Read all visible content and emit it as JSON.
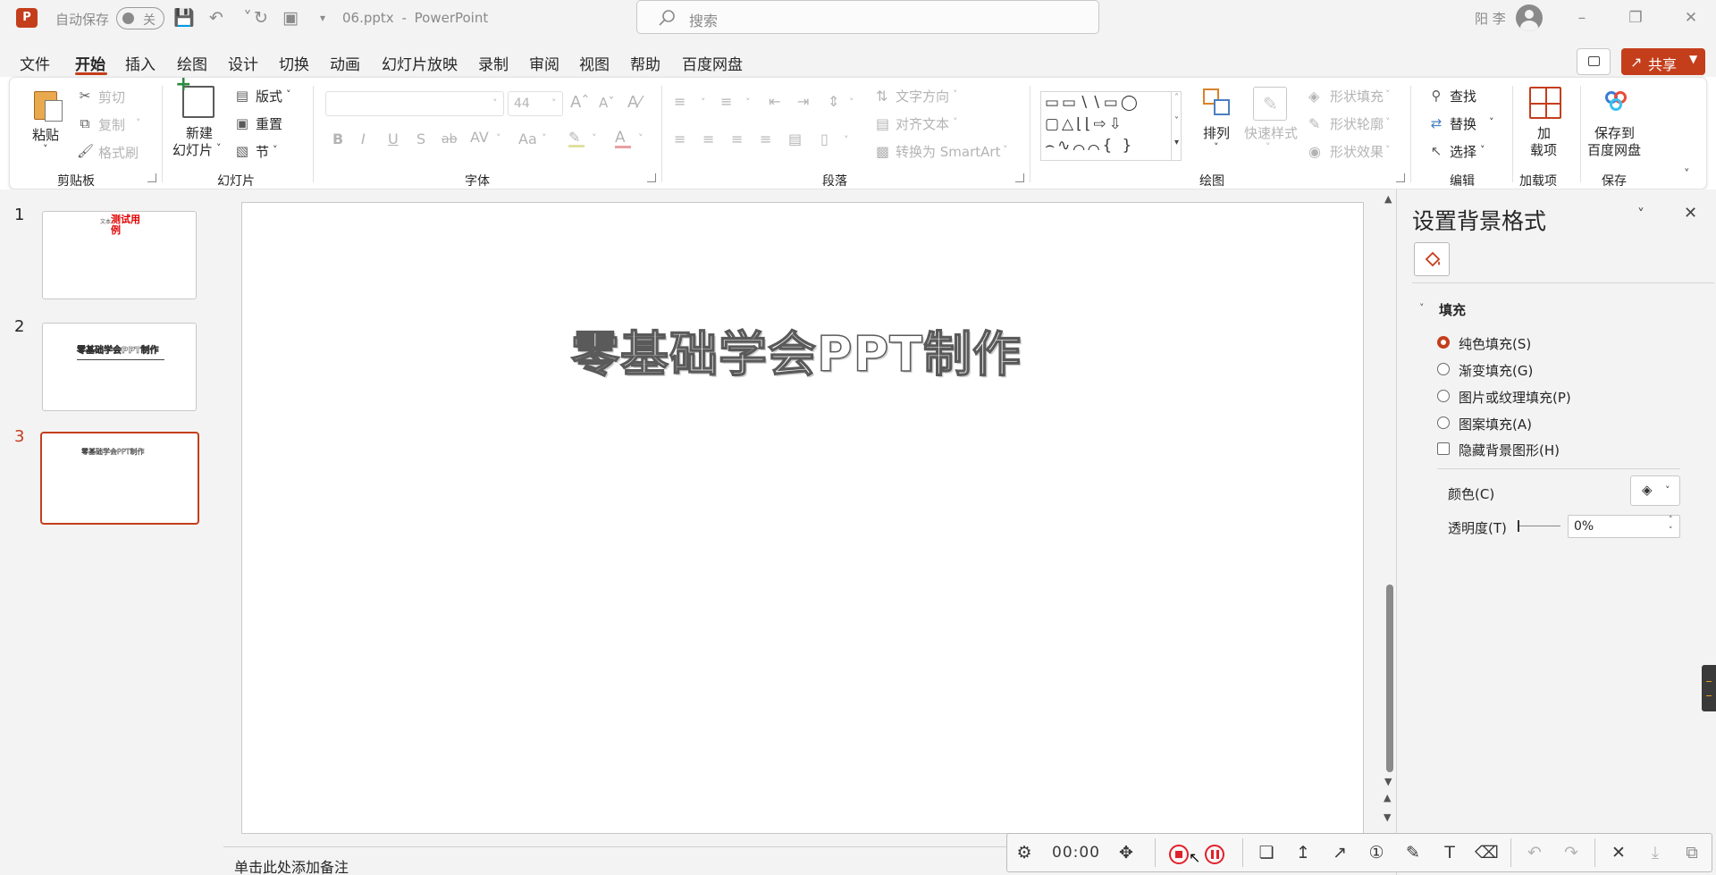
{
  "titlebar": {
    "app_icon": "P",
    "autosave_label": "自动保存",
    "autosave_state": "关",
    "filename": "06.pptx",
    "separator": "-",
    "app_name": "PowerPoint",
    "search_placeholder": "搜索",
    "user_name": "阳 李"
  },
  "menu": {
    "items": [
      "文件",
      "开始",
      "插入",
      "绘图",
      "设计",
      "切换",
      "动画",
      "幻灯片放映",
      "录制",
      "审阅",
      "视图",
      "帮助",
      "百度网盘"
    ],
    "active": "开始",
    "share_label": "共享"
  },
  "ribbon": {
    "clipboard": {
      "paste": "粘贴",
      "cut": "剪切",
      "copy": "复制",
      "format_painter": "格式刷",
      "group": "剪贴板"
    },
    "slides": {
      "new_slide_1": "新建",
      "new_slide_2": "幻灯片",
      "layout": "版式",
      "reset": "重置",
      "section": "节",
      "group": "幻灯片"
    },
    "font": {
      "font_name": "",
      "font_size": "44",
      "bold": "B",
      "italic": "I",
      "underline": "U",
      "shadow": "S",
      "strike": "ab",
      "spacing": "AV",
      "case": "Aa",
      "color_a": "A",
      "group": "字体"
    },
    "paragraph": {
      "text_direction": "文字方向",
      "align_text": "对齐文本",
      "smartart": "转换为 SmartArt",
      "group": "段落"
    },
    "drawing": {
      "arrange": "排列",
      "quick_styles": "快速样式",
      "shape_fill": "形状填充",
      "shape_outline": "形状轮廓",
      "shape_effects": "形状效果",
      "group": "绘图"
    },
    "editing": {
      "find": "查找",
      "replace": "替换",
      "select": "选择",
      "group": "编辑"
    },
    "addins": {
      "label_1": "加",
      "label_2": "载项",
      "group": "加载项"
    },
    "save": {
      "label_1": "保存到",
      "label_2": "百度网盘",
      "group": "保存"
    }
  },
  "thumbnails": [
    {
      "number": "1",
      "text": "测试用例",
      "prefix": "文本"
    },
    {
      "number": "2",
      "text": "零基础学会PPT制作"
    },
    {
      "number": "3",
      "text": "零基础学会PPT制作"
    }
  ],
  "slide": {
    "title": "零基础学会PPT制作"
  },
  "notes": {
    "placeholder": "单击此处添加备注"
  },
  "format_pane": {
    "title": "设置背景格式",
    "section": "填充",
    "options": [
      "纯色填充(S)",
      "渐变填充(G)",
      "图片或纹理填充(P)",
      "图案填充(A)"
    ],
    "selected": "纯色填充(S)",
    "hide_bg": "隐藏背景图形(H)",
    "color_label": "颜色(C)",
    "transparency_label": "透明度(T)",
    "transparency_value": "0%"
  },
  "recorder": {
    "time": "00:00"
  },
  "colors": {
    "accent": "#c43e1c",
    "chrome": "#f3f3f3"
  }
}
